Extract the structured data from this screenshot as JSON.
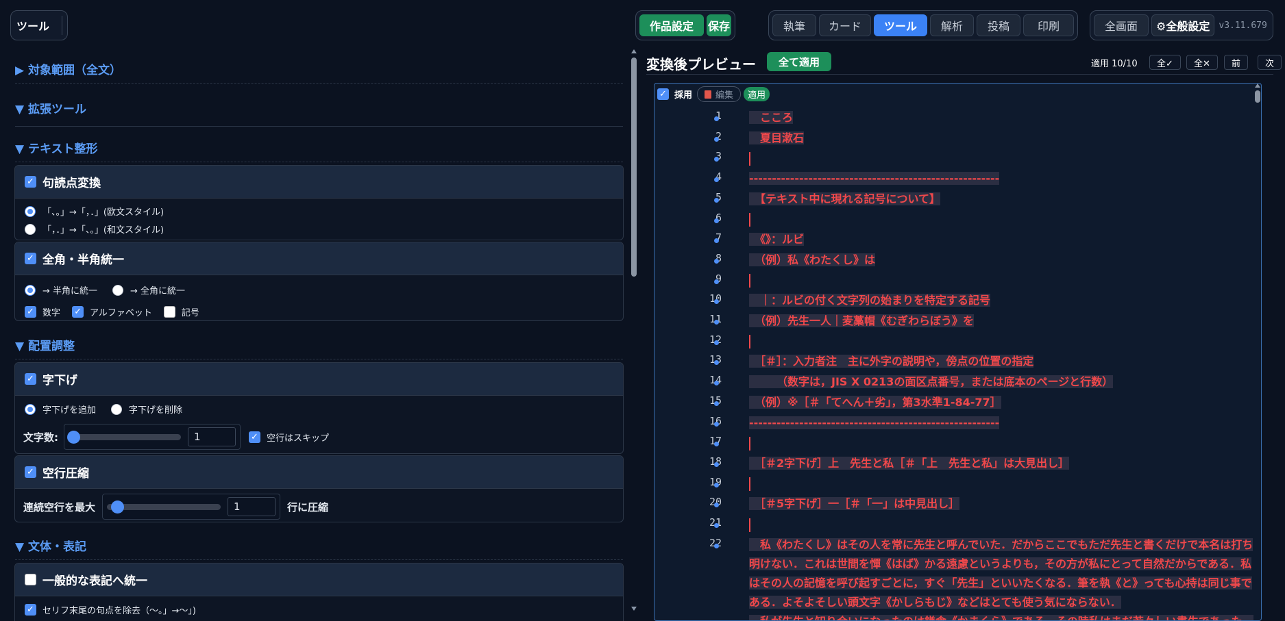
{
  "toolbar": {
    "left_label": "ツール",
    "work_settings": "作品設定",
    "save": "保存",
    "tabs": [
      "執筆",
      "カード",
      "ツール",
      "解析",
      "投稿",
      "印刷"
    ],
    "active_tab": "ツール",
    "fullscreen": "全画面",
    "global_settings": "⚙全般設定",
    "version": "v3.11.679"
  },
  "left": {
    "scope": "▶ 対象範囲（全文）",
    "ext_tools": "▼ 拡張ツール",
    "text_format": "▼ テキスト整形",
    "punct": {
      "title": "句読点変換",
      "opt1": "「、。」→「，．」(欧文スタイル)",
      "opt2": "「，．」→「、。」(和文スタイル)"
    },
    "width": {
      "title": "全角・半角統一",
      "opt_half": "→ 半角に統一",
      "opt_full": "→ 全角に統一",
      "chk_num": "数字",
      "chk_alpha": "アルファベット",
      "chk_sym": "記号"
    },
    "layout": "▼ 配置調整",
    "indent": {
      "title": "字下げ",
      "opt_add": "字下げを追加",
      "opt_del": "字下げを削除",
      "count_label": "文字数:",
      "count_value": "1",
      "skip_empty": "空行はスキップ"
    },
    "compress": {
      "title": "空行圧縮",
      "label": "連続空行を最大",
      "value": "1",
      "suffix": "行に圧縮"
    },
    "style": "▼ 文体・表記",
    "unify": {
      "title": "一般的な表記へ統一",
      "opt": "セリフ末尾の句点を除去（〜。」→〜」)"
    }
  },
  "right": {
    "title": "変換後プレビュー",
    "apply_all": "全て適用",
    "status": "適用 10/10",
    "all_check": "全✓",
    "all_cross": "全✕",
    "prev": "前",
    "next": "次",
    "adopt": "採用",
    "edit": "編集",
    "apply_badge": "適用",
    "lines": [
      {
        "n": "1",
        "t": "　こころ"
      },
      {
        "n": "2",
        "t": "　夏目漱石"
      },
      {
        "n": "3",
        "t": ""
      },
      {
        "n": "4",
        "t": "-------------------------------------------------------"
      },
      {
        "n": "5",
        "t": "　【テキスト中に現れる記号について】"
      },
      {
        "n": "6",
        "t": ""
      },
      {
        "n": "7",
        "t": "　《》：ルビ"
      },
      {
        "n": "8",
        "t": "　（例）私《わたくし》は"
      },
      {
        "n": "9",
        "t": ""
      },
      {
        "n": "10",
        "t": "　｜：ルビの付く文字列の始まりを特定する記号"
      },
      {
        "n": "11",
        "t": "　（例）先生一人｜麦藁帽《むぎわらぼう》を"
      },
      {
        "n": "12",
        "t": ""
      },
      {
        "n": "13",
        "t": "　［＃］：入力者注　主に外字の説明や，傍点の位置の指定"
      },
      {
        "n": "14",
        "t": "　　　（数字は，JIS X 0213の面区点番号，または底本のページと行数）"
      },
      {
        "n": "15",
        "t": "　（例）※［＃「てへん＋劣」，第3水準1-84-77］"
      },
      {
        "n": "16",
        "t": "-------------------------------------------------------"
      },
      {
        "n": "17",
        "t": ""
      },
      {
        "n": "18",
        "t": "　［＃2字下げ］上　先生と私［＃「上　先生と私」は大見出し］"
      },
      {
        "n": "19",
        "t": ""
      },
      {
        "n": "20",
        "t": "　［＃5字下げ］一［＃「一」は中見出し］"
      },
      {
        "n": "21",
        "t": ""
      },
      {
        "n": "22",
        "t": "　私《わたくし》はその人を常に先生と呼んでいた．だからここでもただ先生と書くだけで本名は打ち明けない．これは世間を憚《はば》かる遠慮というよりも，その方が私にとって自然だからである．私はその人の記憶を呼び起すごとに，すぐ「先生」といいたくなる．筆を執《と》っても心持は同じ事である．よそよそしい頭文字《かしらもじ》などはとても使う気にならない．"
      },
      {
        "n": "",
        "t": "　私が先生と知り合いになったのは鎌倉《かまくら》である．その時私はまだ若々しい書生であった．"
      }
    ]
  }
}
